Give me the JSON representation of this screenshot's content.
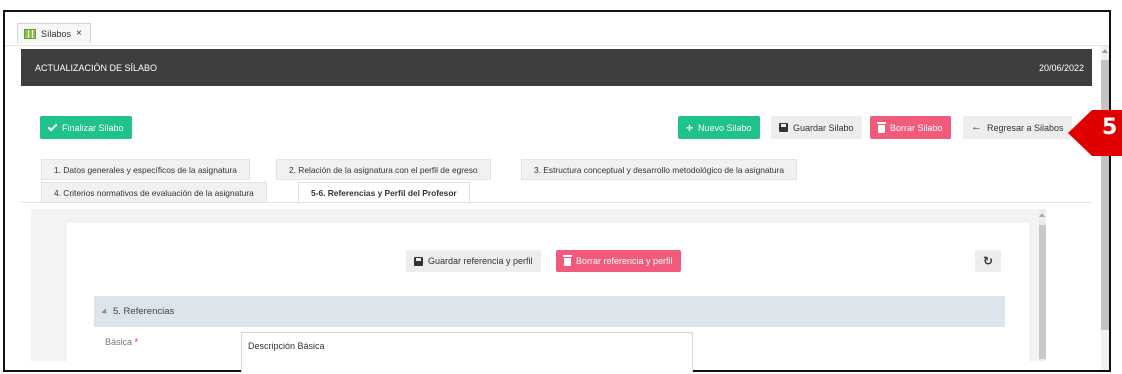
{
  "tab": {
    "label": "Sílabos",
    "close": "×"
  },
  "header": {
    "title": "ACTUALIZACIÓN DE SÍLABO",
    "date": "20/06/2022"
  },
  "actions": {
    "finalize": "Finalizar Silabo",
    "new": "Nuevo Silabo",
    "save": "Guardar Silabo",
    "delete": "Borrar Silabo",
    "back": "Regresar a Silabos"
  },
  "section_tabs": [
    {
      "label": "1. Datos generales y específicos de la asignatura"
    },
    {
      "label": "2. Relación de la asignatura con el perfil de egreso"
    },
    {
      "label": "3. Estructura conceptual y desarrollo metodológico de la asignatura"
    },
    {
      "label": "4. Criterios normativos de evaluación de la asignatura"
    },
    {
      "label": "5-6. Referencias y Perfil del Profesor"
    }
  ],
  "panel": {
    "save_ref": "Guardar referencia y perfil",
    "delete_ref": "Borrar referencia y perfil",
    "section_title": "5. Referencias",
    "basic_label": "Básica",
    "required_mark": "*",
    "basic_placeholder": "Descripción Básica"
  },
  "callout": {
    "number": "5"
  },
  "colors": {
    "green": "#1fc28b",
    "red": "#f25a7b",
    "header": "#3e3e3e",
    "callout": "#e00000"
  }
}
